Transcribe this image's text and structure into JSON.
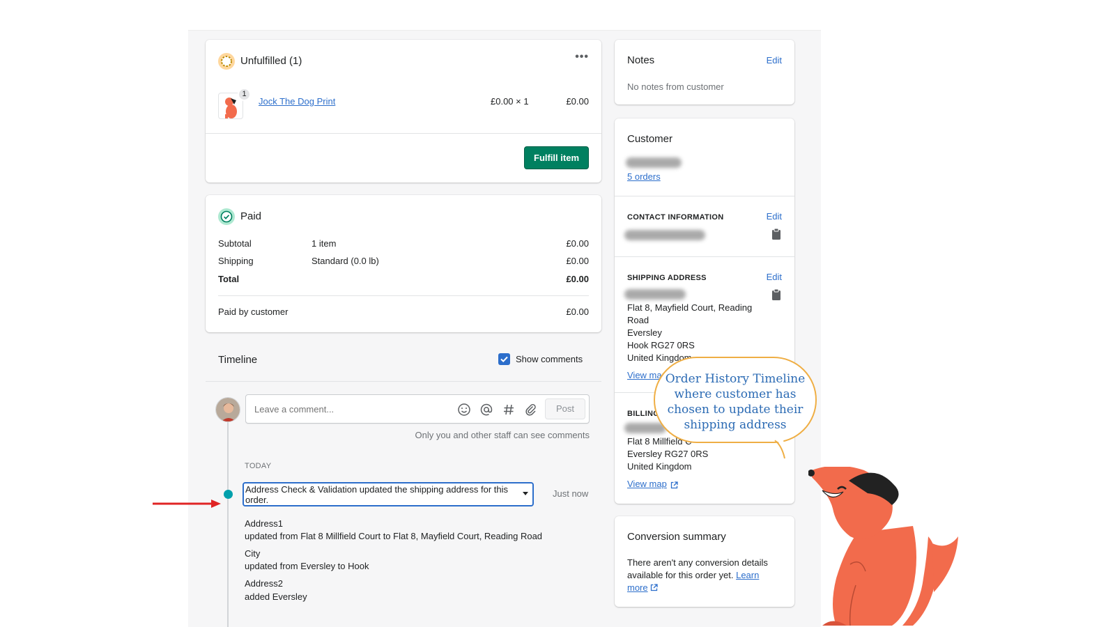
{
  "unfulfilled": {
    "title": "Unfulfilled (1)",
    "item": {
      "qty_badge": "1",
      "name": "Jock The Dog Print",
      "unit_price": "£0.00 × 1",
      "total": "£0.00"
    },
    "fulfill_label": "Fulfill item"
  },
  "paid": {
    "title": "Paid",
    "rows": [
      {
        "label": "Subtotal",
        "detail": "1 item",
        "amount": "£0.00"
      },
      {
        "label": "Shipping",
        "detail": "Standard (0.0 lb)",
        "amount": "£0.00"
      },
      {
        "label": "Total",
        "detail": "",
        "amount": "£0.00"
      }
    ],
    "paid_by_label": "Paid by customer",
    "paid_by_amount": "£0.00"
  },
  "timeline": {
    "title": "Timeline",
    "show_comments_label": "Show comments",
    "comment_placeholder": "Leave a comment...",
    "post_label": "Post",
    "staff_note": "Only you and other staff can see comments",
    "day_label": "TODAY",
    "event_text": "Address Check & Validation updated the shipping address for this order.",
    "event_time": "Just now",
    "changes": [
      {
        "field": "Address1",
        "detail": "updated from Flat 8 Millfield Court to Flat 8, Mayfield Court, Reading Road"
      },
      {
        "field": "City",
        "detail": "updated from Eversley to Hook"
      },
      {
        "field": "Address2",
        "detail": "added Eversley"
      }
    ]
  },
  "notes": {
    "title": "Notes",
    "edit_label": "Edit",
    "text": "No notes from customer"
  },
  "customer": {
    "title": "Customer",
    "orders_link": "5 orders",
    "contact_heading": "CONTACT INFORMATION",
    "contact_edit": "Edit",
    "shipping_heading": "SHIPPING ADDRESS",
    "shipping_edit": "Edit",
    "shipping_lines": [
      "Flat 8, Mayfield Court, Reading",
      "Road",
      "Eversley",
      "Hook RG27 0RS",
      "United Kingdom"
    ],
    "shipping_map": "View map",
    "billing_heading": "BILLING",
    "billing_lines": [
      "Flat 8 Millfield C",
      "Eversley RG27 0RS",
      "United Kingdom"
    ],
    "billing_map": "View map"
  },
  "conversion": {
    "title": "Conversion summary",
    "text": "There aren't any conversion details available for this order yet.",
    "learn_label": "Learn",
    "more_label": "more"
  },
  "callout": {
    "text": "Order History Timeline where customer has chosen to update their shipping address"
  },
  "colors": {
    "primary_green": "#008060",
    "link_blue": "#2c6ecb",
    "callout_border": "#efae44",
    "dog_orange": "#f26b4c",
    "arrow_red": "#e02424"
  }
}
